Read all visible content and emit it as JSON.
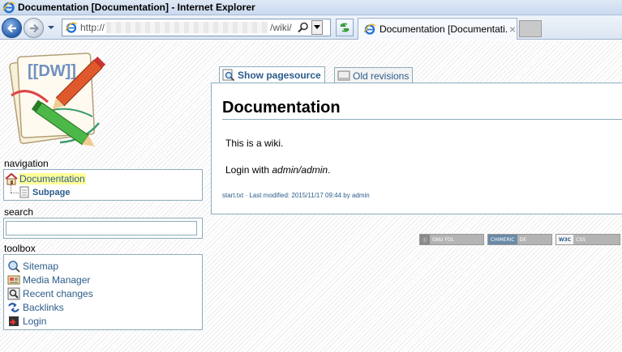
{
  "window": {
    "title": "Documentation [Documentation] - Internet Explorer"
  },
  "browser": {
    "address_prefix": "http://",
    "address_suffix": "/wiki/",
    "tab_label": "Documentation [Documentati...",
    "tab_close": "×"
  },
  "sidebar": {
    "navigation_title": "navigation",
    "nav_items": [
      {
        "label": "Documentation"
      },
      {
        "label": "Subpage"
      }
    ],
    "search_title": "search",
    "search_value": "",
    "toolbox_title": "toolbox",
    "tools": [
      {
        "label": "Sitemap",
        "icon": "sitemap-icon"
      },
      {
        "label": "Media Manager",
        "icon": "media-manager-icon"
      },
      {
        "label": "Recent changes",
        "icon": "recent-changes-icon"
      },
      {
        "label": "Backlinks",
        "icon": "backlinks-icon"
      },
      {
        "label": "Login",
        "icon": "login-icon"
      }
    ]
  },
  "content": {
    "tabs": [
      {
        "label": "Show pagesource"
      },
      {
        "label": "Old revisions"
      }
    ],
    "heading": "Documentation",
    "paragraph1": "This is a wiki.",
    "login_prefix": "Login with ",
    "login_credentials": "admin/admin",
    "login_suffix": ".",
    "meta": "start.txt · Last modified: 2015/11/17 09:44 by admin"
  },
  "badges": [
    {
      "left": "ⓒ",
      "right": "GNU FDL"
    },
    {
      "left": "CHIMERIC",
      "right": "DE"
    },
    {
      "left": "W3C",
      "right": "CSS"
    }
  ],
  "logo_text": "[[DW]]"
}
